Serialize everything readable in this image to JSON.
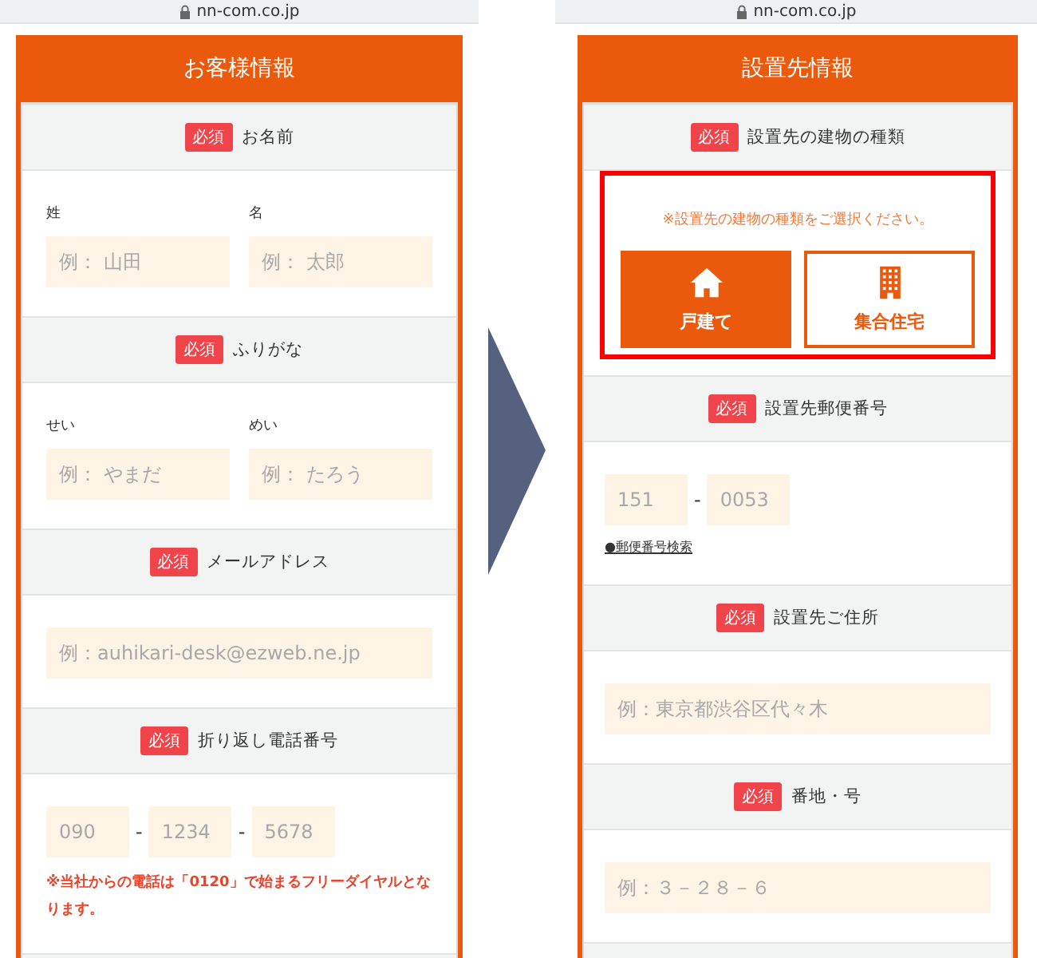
{
  "screens": [
    {
      "url": "nn-com.co.jp",
      "title": "お客様情報",
      "sections": [
        {
          "kind": "pair",
          "badge": "必須",
          "label": "お名前",
          "fields": [
            {
              "label": "姓",
              "placeholder": "例： 山田"
            },
            {
              "label": "名",
              "placeholder": "例： 太郎"
            }
          ]
        },
        {
          "kind": "pair",
          "badge": "必須",
          "label": "ふりがな",
          "fields": [
            {
              "label": "せい",
              "placeholder": "例： やまだ"
            },
            {
              "label": "めい",
              "placeholder": "例： たろう"
            }
          ]
        },
        {
          "kind": "single",
          "badge": "必須",
          "label": "メールアドレス",
          "fields": [
            {
              "placeholder": "例：auhikari-desk@ezweb.ne.jp"
            }
          ]
        },
        {
          "kind": "split",
          "badge": "必須",
          "label": "折り返し電話番号",
          "fields": [
            {
              "placeholder": "090"
            },
            {
              "placeholder": "1234"
            },
            {
              "placeholder": "5678"
            }
          ],
          "separators": [
            "-",
            "-"
          ],
          "note": "※当社からの電話は「0120」で始まるフリーダイヤルとなります。"
        }
      ]
    },
    {
      "url": "nn-com.co.jp",
      "title": "設置先情報",
      "sections": [
        {
          "kind": "choice",
          "badge": "必須",
          "label": "設置先の建物の種類",
          "highlighted": true,
          "note": "※設置先の建物の種類をご選択ください。",
          "options": [
            {
              "kind": "house",
              "label": "戸建て",
              "selected": true
            },
            {
              "kind": "building",
              "label": "集合住宅",
              "selected": false
            }
          ]
        },
        {
          "kind": "split",
          "badge": "必須",
          "label": "設置先郵便番号",
          "fields": [
            {
              "placeholder": "151"
            },
            {
              "placeholder": "0053"
            }
          ],
          "separators": [
            "-"
          ],
          "link": "●郵便番号検索"
        },
        {
          "kind": "single",
          "badge": "必須",
          "label": "設置先ご住所",
          "fields": [
            {
              "placeholder": "例：東京都渋谷区代々木"
            }
          ]
        },
        {
          "kind": "single",
          "badge": "必須",
          "label": "番地・号",
          "fields": [
            {
              "placeholder": "例：３－２８－６"
            }
          ]
        }
      ]
    }
  ]
}
